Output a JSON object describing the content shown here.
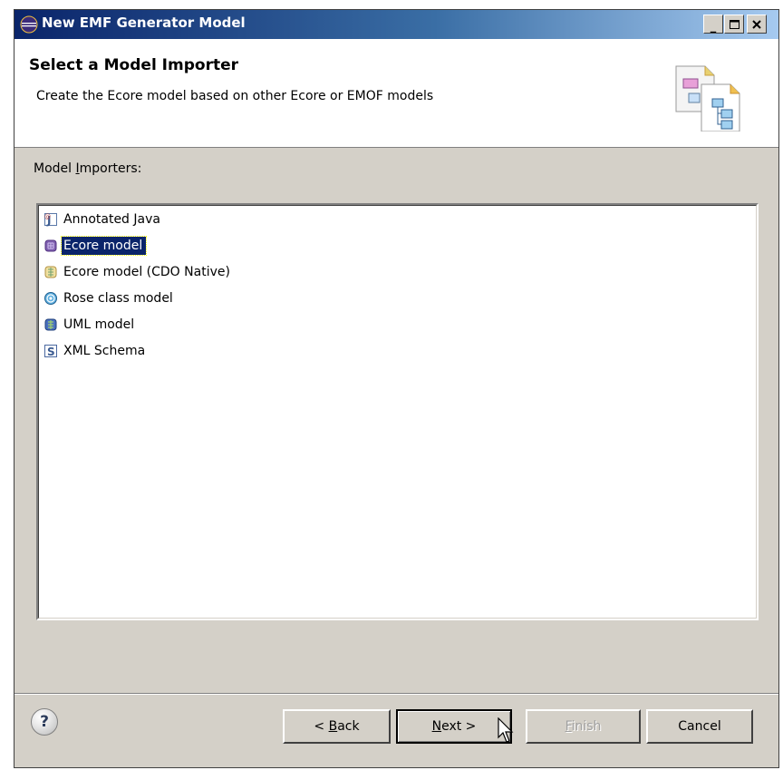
{
  "window": {
    "title": "New EMF Generator Model",
    "controls": {
      "minimize": "_",
      "maximize": "□",
      "close": "×"
    }
  },
  "header": {
    "title": "Select a Model Importer",
    "description": "Create the Ecore model based on other Ecore or EMOF models",
    "graphic_icon": "wizard-banner-icon"
  },
  "importers": {
    "label": "Model Importers:",
    "label_mnemonic": "I",
    "items": [
      {
        "label": "Annotated Java",
        "icon": "annotated-java-icon",
        "selected": false
      },
      {
        "label": "Ecore model",
        "icon": "ecore-model-icon",
        "selected": true
      },
      {
        "label": "Ecore model (CDO Native)",
        "icon": "ecore-cdo-icon",
        "selected": false
      },
      {
        "label": "Rose class model",
        "icon": "rose-class-icon",
        "selected": false
      },
      {
        "label": "UML model",
        "icon": "uml-model-icon",
        "selected": false
      },
      {
        "label": "XML Schema",
        "icon": "xml-schema-icon",
        "selected": false
      }
    ]
  },
  "buttons": {
    "help": "?",
    "back": "< Back",
    "next": "Next >",
    "finish": "Finish",
    "cancel": "Cancel"
  },
  "colors": {
    "dialog_bg": "#d4d0c8",
    "selection_bg": "#0a246a",
    "title_gradient_start": "#0a246a",
    "title_gradient_end": "#a6caf0"
  }
}
